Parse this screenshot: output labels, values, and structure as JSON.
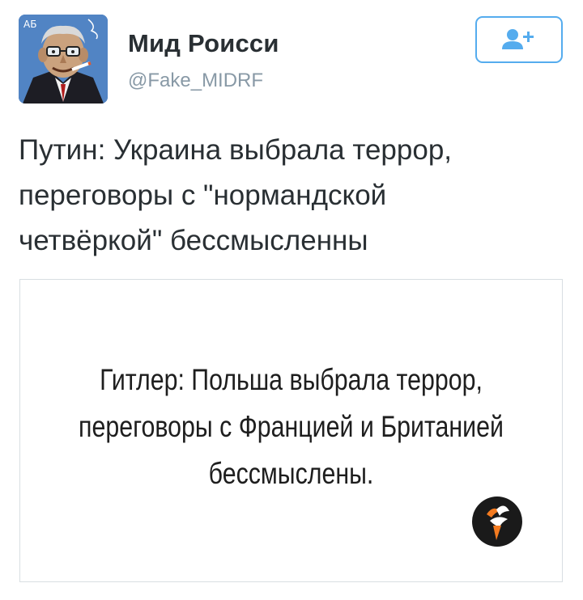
{
  "tweet": {
    "display_name": "Мид Роисси",
    "handle": "@Fake_MIDRF",
    "text_lines": [
      "Путин: Украина выбрала террор,",
      "переговоры с \"нормандской",
      "четвёркой\" бессмысленны"
    ]
  },
  "media": {
    "caption_lines": [
      "Гитлер: Польша выбрала террор,",
      "переговоры с Францией и Британией",
      "бессмыслены."
    ]
  },
  "colors": {
    "accent": "#55acee",
    "handle": "#8899a6",
    "text": "#292f33",
    "logo_orange": "#f47b20"
  },
  "icons": {
    "follow": "follow-person-plus-icon",
    "logo": "rfe-rl-bird-logo"
  }
}
